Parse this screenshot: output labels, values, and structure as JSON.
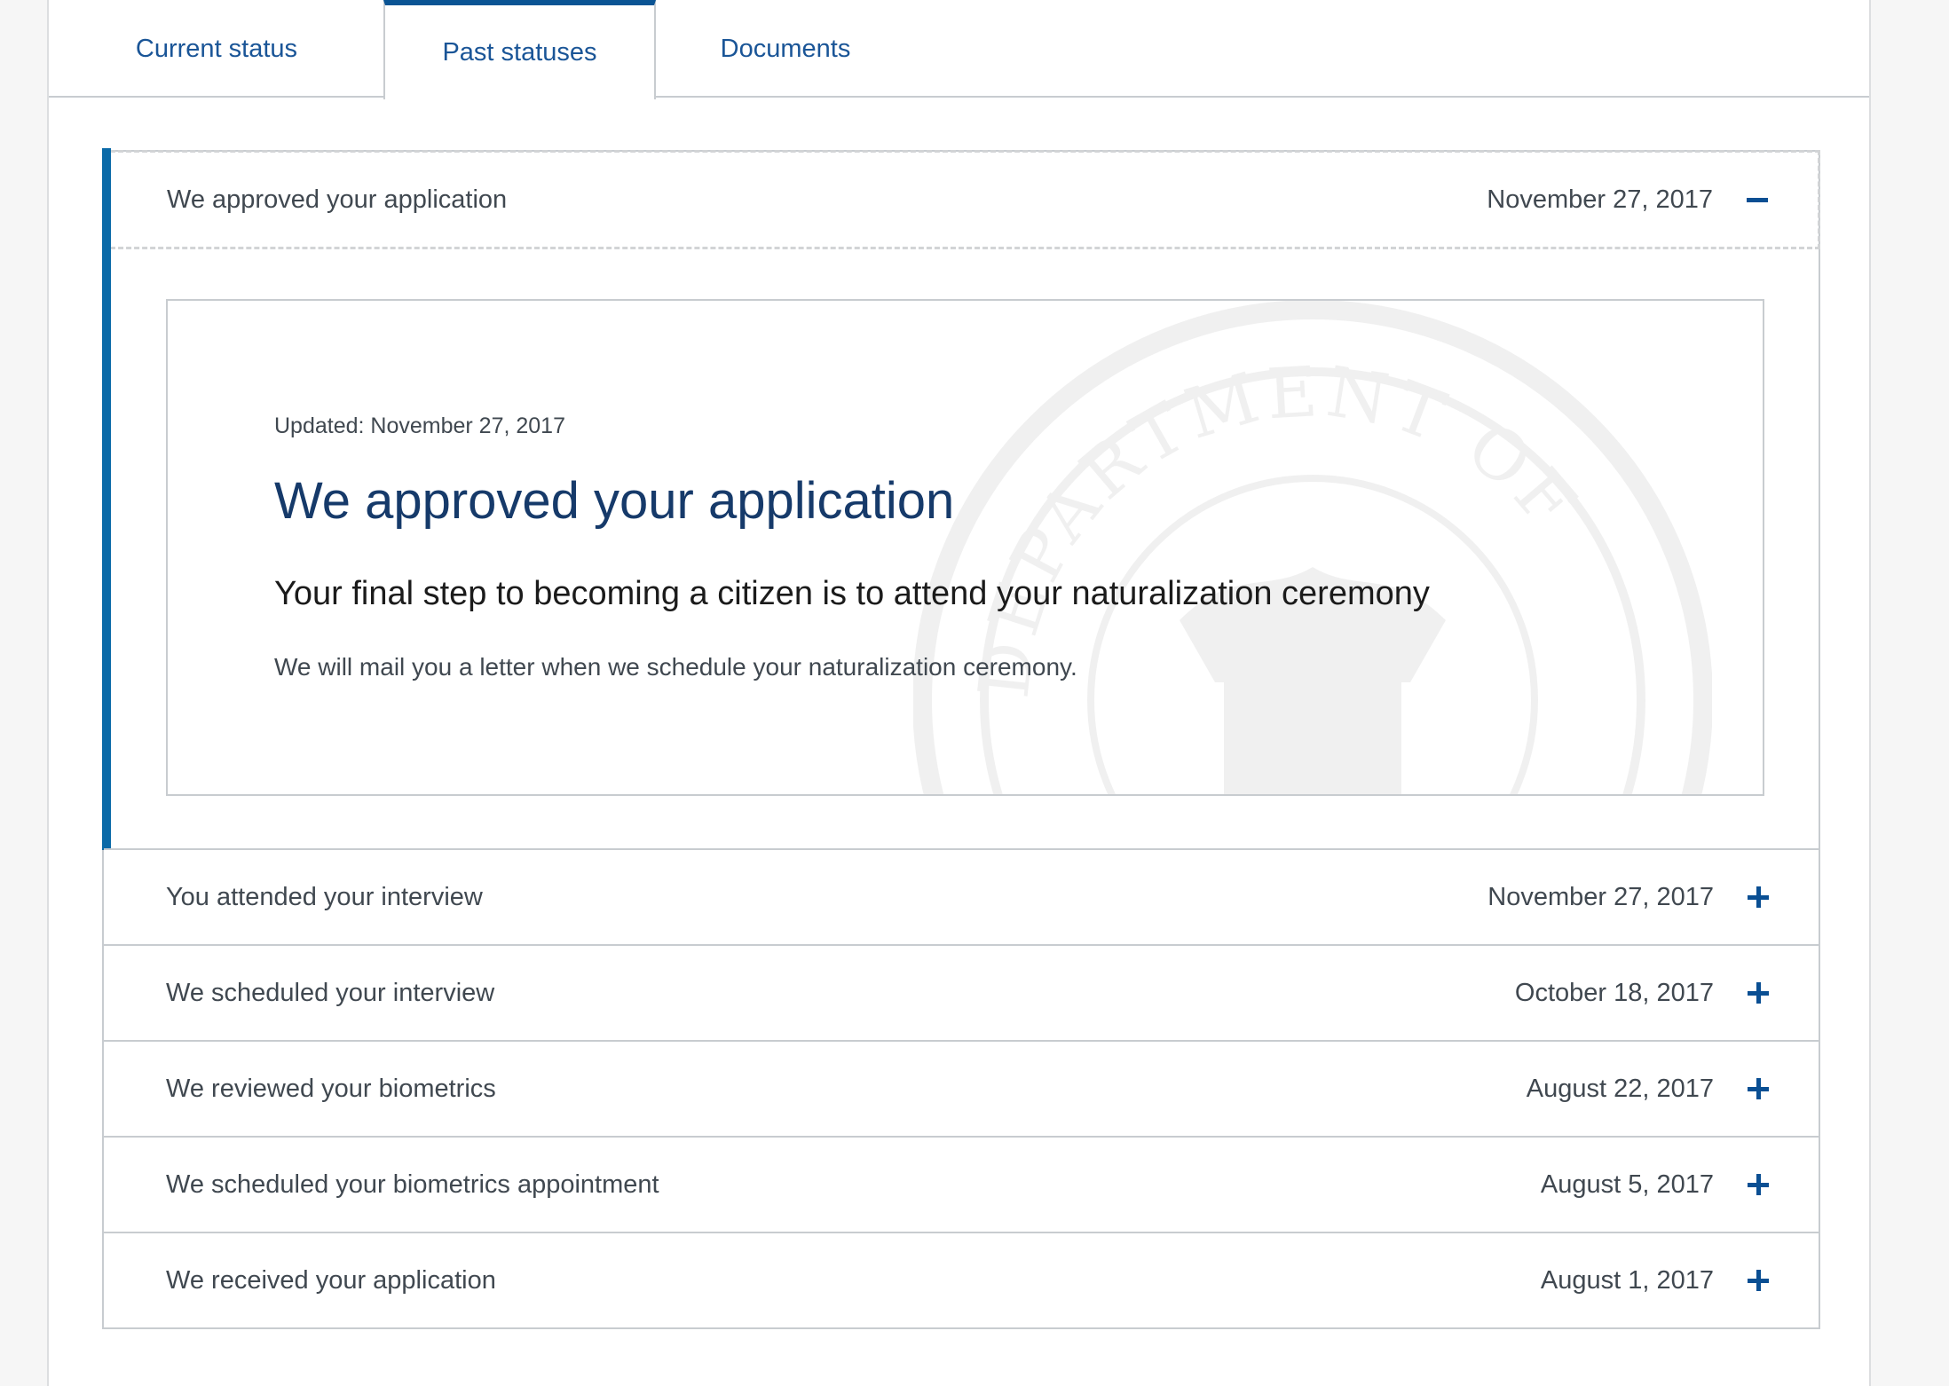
{
  "tabs": [
    {
      "label": "Current status",
      "active": false
    },
    {
      "label": "Past statuses",
      "active": true
    },
    {
      "label": "Documents",
      "active": false
    }
  ],
  "expanded": {
    "title": "We approved your application",
    "date": "November 27, 2017",
    "card": {
      "updated": "Updated: November 27, 2017",
      "heading": "We approved your application",
      "subheading": "Your final step to becoming a citizen is to attend your naturalization ceremony",
      "body": "We will mail you a letter when we schedule your naturalization ceremony.",
      "seal_text": "DEPARTMENT OF"
    }
  },
  "history": [
    {
      "title": "You attended your interview",
      "date": "November 27, 2017"
    },
    {
      "title": "We scheduled your interview",
      "date": "October 18, 2017"
    },
    {
      "title": "We reviewed your biometrics",
      "date": "August 22, 2017"
    },
    {
      "title": "We scheduled your biometrics appointment",
      "date": "August 5, 2017"
    },
    {
      "title": "We received your application",
      "date": "August 1, 2017"
    }
  ],
  "colors": {
    "tab_text": "#1a5597",
    "active_tab_border": "#0a5494",
    "accent_bar": "#0b6aa8",
    "heading": "#163a6a",
    "toggle_icon": "#0a4f93"
  },
  "icons": {
    "collapse": "minus-icon",
    "expand": "plus-icon",
    "watermark": "department-seal"
  }
}
